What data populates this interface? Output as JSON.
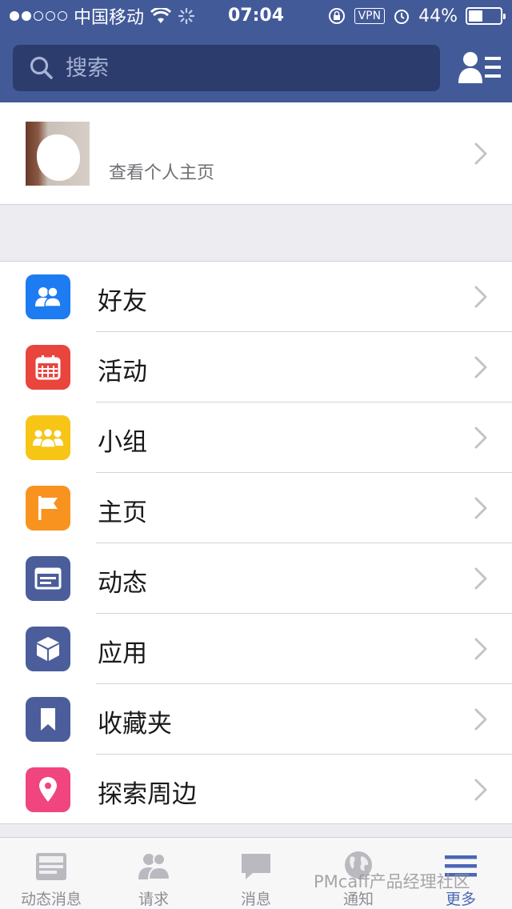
{
  "status_bar": {
    "carrier": "中国移动",
    "time": "07:04",
    "vpn": "VPN",
    "battery_text": "44%",
    "battery_level": 0.44,
    "signal_dots_filled": 2,
    "signal_dots_total": 5
  },
  "search": {
    "placeholder": "搜索"
  },
  "profile": {
    "link_label": "查看个人主页"
  },
  "menu": {
    "items": [
      {
        "label": "好友",
        "icon": "friends-icon",
        "color": "#1d7cf2"
      },
      {
        "label": "活动",
        "icon": "calendar-icon",
        "color": "#e9453d"
      },
      {
        "label": "小组",
        "icon": "groups-icon",
        "color": "#f6c516"
      },
      {
        "label": "主页",
        "icon": "flag-icon",
        "color": "#f7931e"
      },
      {
        "label": "动态",
        "icon": "feed-icon",
        "color": "#4b5d9b"
      },
      {
        "label": "应用",
        "icon": "cube-icon",
        "color": "#4b5d9b"
      },
      {
        "label": "收藏夹",
        "icon": "bookmark-icon",
        "color": "#4b5d9b"
      },
      {
        "label": "探索周边",
        "icon": "location-pin-icon",
        "color": "#f0457e"
      }
    ]
  },
  "tabs": [
    {
      "label": "动态消息",
      "icon": "news-feed-icon"
    },
    {
      "label": "请求",
      "icon": "friend-requests-icon"
    },
    {
      "label": "消息",
      "icon": "messages-icon"
    },
    {
      "label": "通知",
      "icon": "globe-icon"
    },
    {
      "label": "更多",
      "icon": "more-icon",
      "active": true
    }
  ],
  "watermark": "PMcaff产品经理社区",
  "colors": {
    "header": "#435a99",
    "search_bg": "#2c3c6d",
    "accent": "#4a67b3"
  }
}
